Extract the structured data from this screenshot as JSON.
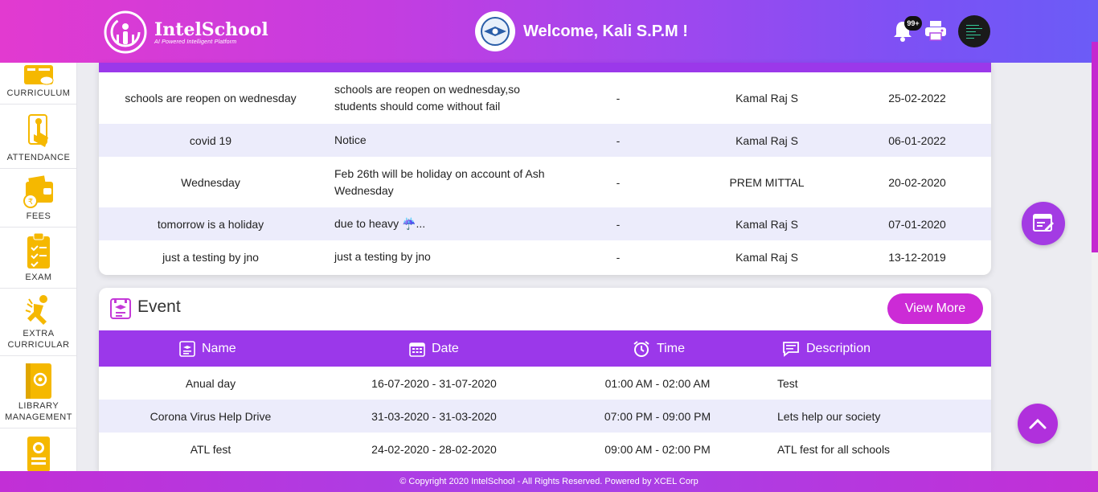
{
  "header": {
    "logo_name": "IntelSchool",
    "logo_tagline": "AI Powered Intelligent Platform",
    "welcome": "Welcome, Kali S.P.M !",
    "notification_count": "99+",
    "icons": [
      "bell-icon",
      "printer-icon"
    ]
  },
  "sidebar": {
    "items": [
      {
        "label": "CURRICULUM",
        "icon": "curriculum-icon"
      },
      {
        "label": "ATTENDANCE",
        "icon": "attendance-icon"
      },
      {
        "label": "FEES",
        "icon": "fees-icon"
      },
      {
        "label": "EXAM",
        "icon": "exam-icon"
      },
      {
        "label": "EXTRA CURRICULAR",
        "icon": "extra-curricular-icon"
      },
      {
        "label": "LIBRARY MANAGEMENT",
        "icon": "library-icon"
      },
      {
        "label": "",
        "icon": "certificate-icon"
      }
    ]
  },
  "notices": {
    "rows": [
      {
        "title": "schools are reopen on wednesday",
        "description": "schools are reopen on wednesday,so students should come without fail",
        "attachment": "-",
        "author": "Kamal Raj S",
        "date": "25-02-2022"
      },
      {
        "title": "covid 19",
        "description": "Notice",
        "attachment": "-",
        "author": "Kamal Raj S",
        "date": "06-01-2022"
      },
      {
        "title": "Wednesday",
        "description": "Feb 26th will be holiday on account of Ash Wednesday",
        "attachment": "-",
        "author": "PREM MITTAL",
        "date": "20-02-2020"
      },
      {
        "title": "tomorrow is a holiday",
        "description": "due to heavy ☔...",
        "attachment": "-",
        "author": "Kamal Raj S",
        "date": "07-01-2020"
      },
      {
        "title": "just a testing by jno",
        "description": "just a testing by jno",
        "attachment": "-",
        "author": "Kamal Raj S",
        "date": "13-12-2019"
      }
    ]
  },
  "events": {
    "title": "Event",
    "view_more": "View More",
    "columns": {
      "name": "Name",
      "date": "Date",
      "time": "Time",
      "description": "Description"
    },
    "rows": [
      {
        "name": "Anual day",
        "date": "16-07-2020 - 31-07-2020",
        "time": "01:00 AM - 02:00 AM",
        "description": "Test"
      },
      {
        "name": "Corona Virus Help Drive",
        "date": "31-03-2020 - 31-03-2020",
        "time": "07:00 PM - 09:00 PM",
        "description": "Lets help our society"
      },
      {
        "name": "ATL fest",
        "date": "24-02-2020 - 28-02-2020",
        "time": "09:00 AM - 02:00 PM",
        "description": "ATL fest for all schools"
      }
    ]
  },
  "footer": {
    "text": "© Copyright 2020 IntelSchool - All Rights Reserved. Powered by XCEL Corp"
  },
  "colors": {
    "accent": "#9b38ea",
    "pink": "#cc2bd6",
    "row_alt": "#ececfb",
    "icon_yellow": "#f5b800"
  }
}
